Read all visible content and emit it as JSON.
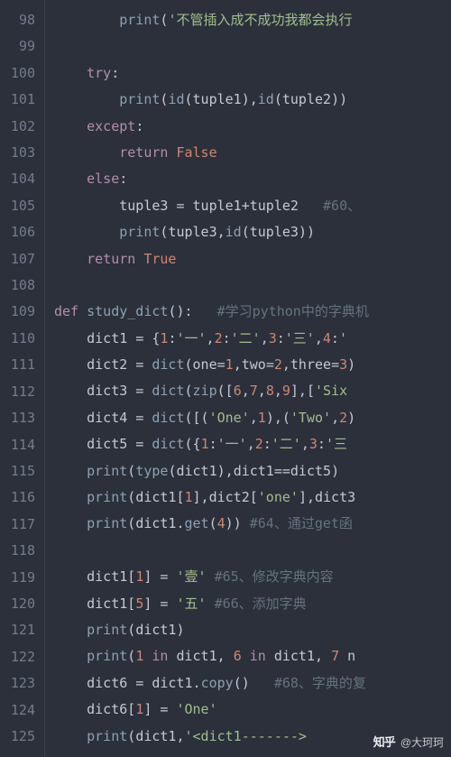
{
  "editor": {
    "first_line_number": 98,
    "lines": [
      {
        "tokens": [
          [
            "",
            "        "
          ],
          [
            "fn",
            "print"
          ],
          [
            "op",
            "("
          ],
          [
            "str",
            "'不管插入成不成功我都会执行"
          ]
        ]
      },
      {
        "tokens": [
          [
            "",
            ""
          ]
        ]
      },
      {
        "tokens": [
          [
            "",
            "    "
          ],
          [
            "kw",
            "try"
          ],
          [
            "op",
            ":"
          ]
        ]
      },
      {
        "tokens": [
          [
            "",
            "        "
          ],
          [
            "fn",
            "print"
          ],
          [
            "op",
            "("
          ],
          [
            "fn",
            "id"
          ],
          [
            "op",
            "("
          ],
          [
            "id",
            "tuple1"
          ],
          [
            "op",
            "),"
          ],
          [
            "fn",
            "id"
          ],
          [
            "op",
            "("
          ],
          [
            "id",
            "tuple2"
          ],
          [
            "op",
            "))"
          ]
        ]
      },
      {
        "tokens": [
          [
            "",
            "    "
          ],
          [
            "kw",
            "except"
          ],
          [
            "op",
            ":"
          ]
        ]
      },
      {
        "tokens": [
          [
            "",
            "        "
          ],
          [
            "kw",
            "return"
          ],
          [
            "",
            " "
          ],
          [
            "bool",
            "False"
          ]
        ]
      },
      {
        "tokens": [
          [
            "",
            "    "
          ],
          [
            "kw",
            "else"
          ],
          [
            "op",
            ":"
          ]
        ]
      },
      {
        "tokens": [
          [
            "",
            "        "
          ],
          [
            "id",
            "tuple3"
          ],
          [
            "",
            " "
          ],
          [
            "op",
            "="
          ],
          [
            "",
            " "
          ],
          [
            "id",
            "tuple1"
          ],
          [
            "op",
            "+"
          ],
          [
            "id",
            "tuple2"
          ],
          [
            "",
            "   "
          ],
          [
            "com",
            "#60、"
          ]
        ]
      },
      {
        "tokens": [
          [
            "",
            "        "
          ],
          [
            "fn",
            "print"
          ],
          [
            "op",
            "("
          ],
          [
            "id",
            "tuple3"
          ],
          [
            "op",
            ","
          ],
          [
            "fn",
            "id"
          ],
          [
            "op",
            "("
          ],
          [
            "id",
            "tuple3"
          ],
          [
            "op",
            "))"
          ]
        ]
      },
      {
        "tokens": [
          [
            "",
            "    "
          ],
          [
            "kw",
            "return"
          ],
          [
            "",
            " "
          ],
          [
            "bool",
            "True"
          ]
        ]
      },
      {
        "tokens": [
          [
            "",
            ""
          ]
        ]
      },
      {
        "tokens": [
          [
            "kw",
            "def"
          ],
          [
            "",
            " "
          ],
          [
            "def",
            "study_dict"
          ],
          [
            "op",
            "():"
          ],
          [
            "",
            "   "
          ],
          [
            "com",
            "#学习python中的字典机"
          ]
        ]
      },
      {
        "tokens": [
          [
            "",
            "    "
          ],
          [
            "id",
            "dict1"
          ],
          [
            "",
            " "
          ],
          [
            "op",
            "="
          ],
          [
            "",
            " "
          ],
          [
            "op",
            "{"
          ],
          [
            "num",
            "1"
          ],
          [
            "op",
            ":"
          ],
          [
            "str",
            "'一'"
          ],
          [
            "op",
            ","
          ],
          [
            "num",
            "2"
          ],
          [
            "op",
            ":"
          ],
          [
            "str",
            "'二'"
          ],
          [
            "op",
            ","
          ],
          [
            "num",
            "3"
          ],
          [
            "op",
            ":"
          ],
          [
            "str",
            "'三'"
          ],
          [
            "op",
            ","
          ],
          [
            "num",
            "4"
          ],
          [
            "op",
            ":"
          ],
          [
            "str",
            "'"
          ]
        ]
      },
      {
        "tokens": [
          [
            "",
            "    "
          ],
          [
            "id",
            "dict2"
          ],
          [
            "",
            " "
          ],
          [
            "op",
            "="
          ],
          [
            "",
            " "
          ],
          [
            "fn",
            "dict"
          ],
          [
            "op",
            "("
          ],
          [
            "id",
            "one"
          ],
          [
            "op",
            "="
          ],
          [
            "num",
            "1"
          ],
          [
            "op",
            ","
          ],
          [
            "id",
            "two"
          ],
          [
            "op",
            "="
          ],
          [
            "num",
            "2"
          ],
          [
            "op",
            ","
          ],
          [
            "id",
            "three"
          ],
          [
            "op",
            "="
          ],
          [
            "num",
            "3"
          ],
          [
            "op",
            ")"
          ]
        ]
      },
      {
        "tokens": [
          [
            "",
            "    "
          ],
          [
            "id",
            "dict3"
          ],
          [
            "",
            " "
          ],
          [
            "op",
            "="
          ],
          [
            "",
            " "
          ],
          [
            "fn",
            "dict"
          ],
          [
            "op",
            "("
          ],
          [
            "fn",
            "zip"
          ],
          [
            "op",
            "(["
          ],
          [
            "num",
            "6"
          ],
          [
            "op",
            ","
          ],
          [
            "num",
            "7"
          ],
          [
            "op",
            ","
          ],
          [
            "num",
            "8"
          ],
          [
            "op",
            ","
          ],
          [
            "num",
            "9"
          ],
          [
            "op",
            "],["
          ],
          [
            "str",
            "'Six"
          ]
        ]
      },
      {
        "tokens": [
          [
            "",
            "    "
          ],
          [
            "id",
            "dict4"
          ],
          [
            "",
            " "
          ],
          [
            "op",
            "="
          ],
          [
            "",
            " "
          ],
          [
            "fn",
            "dict"
          ],
          [
            "op",
            "([("
          ],
          [
            "str",
            "'One'"
          ],
          [
            "op",
            ","
          ],
          [
            "num",
            "1"
          ],
          [
            "op",
            "),("
          ],
          [
            "str",
            "'Two'"
          ],
          [
            "op",
            ","
          ],
          [
            "num",
            "2"
          ],
          [
            "op",
            ")"
          ]
        ]
      },
      {
        "tokens": [
          [
            "",
            "    "
          ],
          [
            "id",
            "dict5"
          ],
          [
            "",
            " "
          ],
          [
            "op",
            "="
          ],
          [
            "",
            " "
          ],
          [
            "fn",
            "dict"
          ],
          [
            "op",
            "({"
          ],
          [
            "num",
            "1"
          ],
          [
            "op",
            ":"
          ],
          [
            "str",
            "'一'"
          ],
          [
            "op",
            ","
          ],
          [
            "num",
            "2"
          ],
          [
            "op",
            ":"
          ],
          [
            "str",
            "'二'"
          ],
          [
            "op",
            ","
          ],
          [
            "num",
            "3"
          ],
          [
            "op",
            ":"
          ],
          [
            "str",
            "'三"
          ]
        ]
      },
      {
        "tokens": [
          [
            "",
            "    "
          ],
          [
            "fn",
            "print"
          ],
          [
            "op",
            "("
          ],
          [
            "fn",
            "type"
          ],
          [
            "op",
            "("
          ],
          [
            "id",
            "dict1"
          ],
          [
            "op",
            "),"
          ],
          [
            "id",
            "dict1"
          ],
          [
            "op",
            "=="
          ],
          [
            "id",
            "dict5"
          ],
          [
            "op",
            ")"
          ]
        ]
      },
      {
        "tokens": [
          [
            "",
            "    "
          ],
          [
            "fn",
            "print"
          ],
          [
            "op",
            "("
          ],
          [
            "id",
            "dict1"
          ],
          [
            "op",
            "["
          ],
          [
            "num",
            "1"
          ],
          [
            "op",
            "],"
          ],
          [
            "id",
            "dict2"
          ],
          [
            "op",
            "["
          ],
          [
            "str",
            "'one'"
          ],
          [
            "op",
            "],"
          ],
          [
            "id",
            "dict3"
          ]
        ]
      },
      {
        "tokens": [
          [
            "",
            "    "
          ],
          [
            "fn",
            "print"
          ],
          [
            "op",
            "("
          ],
          [
            "id",
            "dict1"
          ],
          [
            "op",
            "."
          ],
          [
            "fn",
            "get"
          ],
          [
            "op",
            "("
          ],
          [
            "num",
            "4"
          ],
          [
            "op",
            "))"
          ],
          [
            "",
            " "
          ],
          [
            "com",
            "#64、通过get函"
          ]
        ]
      },
      {
        "tokens": [
          [
            "",
            ""
          ]
        ]
      },
      {
        "tokens": [
          [
            "",
            "    "
          ],
          [
            "id",
            "dict1"
          ],
          [
            "op",
            "["
          ],
          [
            "num",
            "1"
          ],
          [
            "op",
            "]"
          ],
          [
            "",
            " "
          ],
          [
            "op",
            "="
          ],
          [
            "",
            " "
          ],
          [
            "str",
            "'壹'"
          ],
          [
            "",
            " "
          ],
          [
            "com",
            "#65、修改字典内容"
          ]
        ]
      },
      {
        "tokens": [
          [
            "",
            "    "
          ],
          [
            "id",
            "dict1"
          ],
          [
            "op",
            "["
          ],
          [
            "num",
            "5"
          ],
          [
            "op",
            "]"
          ],
          [
            "",
            " "
          ],
          [
            "op",
            "="
          ],
          [
            "",
            " "
          ],
          [
            "str",
            "'五'"
          ],
          [
            "",
            " "
          ],
          [
            "com",
            "#66、添加字典"
          ]
        ]
      },
      {
        "tokens": [
          [
            "",
            "    "
          ],
          [
            "fn",
            "print"
          ],
          [
            "op",
            "("
          ],
          [
            "id",
            "dict1"
          ],
          [
            "op",
            ")"
          ]
        ]
      },
      {
        "tokens": [
          [
            "",
            "    "
          ],
          [
            "fn",
            "print"
          ],
          [
            "op",
            "("
          ],
          [
            "num",
            "1"
          ],
          [
            "",
            " "
          ],
          [
            "kw",
            "in"
          ],
          [
            "",
            " "
          ],
          [
            "id",
            "dict1"
          ],
          [
            "op",
            ","
          ],
          [
            "",
            " "
          ],
          [
            "num",
            "6"
          ],
          [
            "",
            " "
          ],
          [
            "kw",
            "in"
          ],
          [
            "",
            " "
          ],
          [
            "id",
            "dict1"
          ],
          [
            "op",
            ","
          ],
          [
            "",
            " "
          ],
          [
            "num",
            "7"
          ],
          [
            "",
            " "
          ],
          [
            "id",
            "n"
          ]
        ]
      },
      {
        "tokens": [
          [
            "",
            "    "
          ],
          [
            "id",
            "dict6"
          ],
          [
            "",
            " "
          ],
          [
            "op",
            "="
          ],
          [
            "",
            " "
          ],
          [
            "id",
            "dict1"
          ],
          [
            "op",
            "."
          ],
          [
            "fn",
            "copy"
          ],
          [
            "op",
            "()"
          ],
          [
            "",
            "   "
          ],
          [
            "com",
            "#68、字典的复"
          ]
        ]
      },
      {
        "tokens": [
          [
            "",
            "    "
          ],
          [
            "id",
            "dict6"
          ],
          [
            "op",
            "["
          ],
          [
            "num",
            "1"
          ],
          [
            "op",
            "]"
          ],
          [
            "",
            " "
          ],
          [
            "op",
            "="
          ],
          [
            "",
            " "
          ],
          [
            "str",
            "'One'"
          ]
        ]
      },
      {
        "tokens": [
          [
            "",
            "    "
          ],
          [
            "fn",
            "print"
          ],
          [
            "op",
            "("
          ],
          [
            "id",
            "dict1"
          ],
          [
            "op",
            ","
          ],
          [
            "str",
            "'<dict1------->"
          ]
        ]
      }
    ]
  },
  "watermark": {
    "logo": "知乎",
    "text": "@大珂珂"
  }
}
